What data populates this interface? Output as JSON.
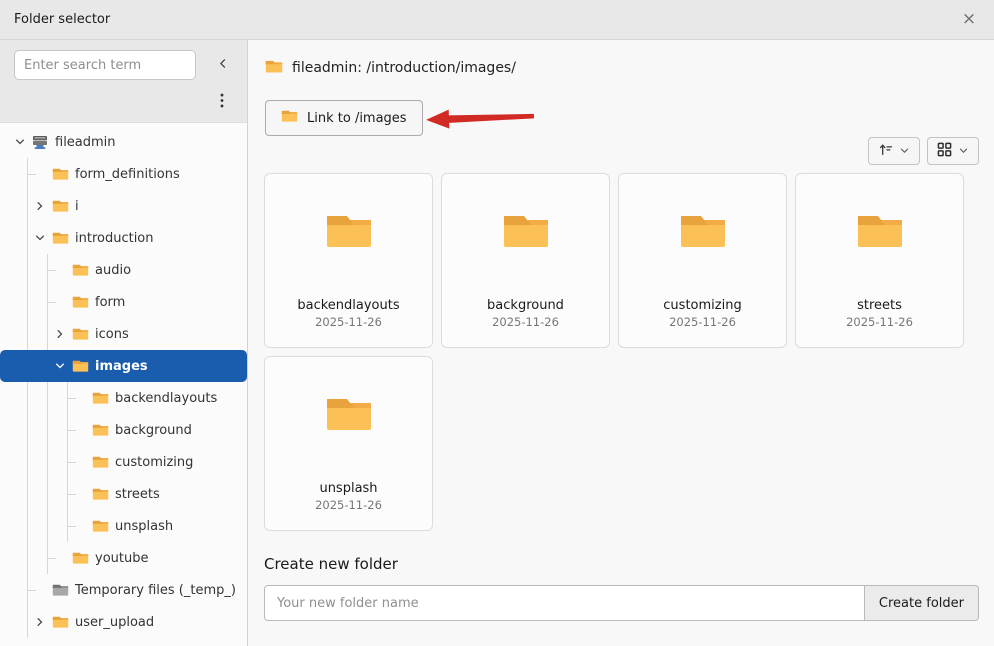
{
  "window": {
    "title": "Folder selector",
    "close_icon": "×"
  },
  "sidebar": {
    "search_placeholder": "Enter search term",
    "tree": [
      {
        "label": "fileadmin",
        "depth": 0,
        "chevron": "down",
        "icon": "storage",
        "selected": false
      },
      {
        "label": "form_definitions",
        "depth": 1,
        "chevron": "none",
        "icon": "folder",
        "selected": false
      },
      {
        "label": "i",
        "depth": 1,
        "chevron": "right",
        "icon": "folder",
        "selected": false
      },
      {
        "label": "introduction",
        "depth": 1,
        "chevron": "down",
        "icon": "folder",
        "selected": false
      },
      {
        "label": "audio",
        "depth": 2,
        "chevron": "none",
        "icon": "folder",
        "selected": false
      },
      {
        "label": "form",
        "depth": 2,
        "chevron": "none",
        "icon": "folder",
        "selected": false
      },
      {
        "label": "icons",
        "depth": 2,
        "chevron": "right",
        "icon": "folder",
        "selected": false
      },
      {
        "label": "images",
        "depth": 2,
        "chevron": "down",
        "icon": "folder",
        "selected": true
      },
      {
        "label": "backendlayouts",
        "depth": 3,
        "chevron": "none",
        "icon": "folder",
        "selected": false
      },
      {
        "label": "background",
        "depth": 3,
        "chevron": "none",
        "icon": "folder",
        "selected": false
      },
      {
        "label": "customizing",
        "depth": 3,
        "chevron": "none",
        "icon": "folder",
        "selected": false
      },
      {
        "label": "streets",
        "depth": 3,
        "chevron": "none",
        "icon": "folder",
        "selected": false
      },
      {
        "label": "unsplash",
        "depth": 3,
        "chevron": "none",
        "icon": "folder",
        "selected": false
      },
      {
        "label": "youtube",
        "depth": 2,
        "chevron": "none",
        "icon": "folder",
        "selected": false
      },
      {
        "label": "Temporary files (_temp_)",
        "depth": 1,
        "chevron": "none",
        "icon": "folder-gray",
        "selected": false
      },
      {
        "label": "user_upload",
        "depth": 1,
        "chevron": "right",
        "icon": "folder",
        "selected": false
      }
    ]
  },
  "main": {
    "path_label": "fileadmin: /introduction/images/",
    "link_button_label": "Link to /images",
    "folders": [
      {
        "name": "backendlayouts",
        "date": "2025-11-26"
      },
      {
        "name": "background",
        "date": "2025-11-26"
      },
      {
        "name": "customizing",
        "date": "2025-11-26"
      },
      {
        "name": "streets",
        "date": "2025-11-26"
      },
      {
        "name": "unsplash",
        "date": "2025-11-26"
      }
    ],
    "create_heading": "Create new folder",
    "create_placeholder": "Your new folder name",
    "create_button_label": "Create folder"
  },
  "colors": {
    "selected_blue": "#1a5cad",
    "arrow_red": "#d12a25",
    "folder_body": "#FBC157",
    "folder_tab": "#E8A33C",
    "header_gray": "#e8e8e8"
  }
}
